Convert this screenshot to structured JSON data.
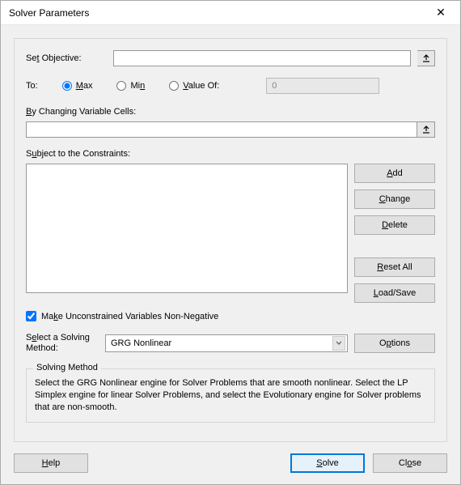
{
  "title": "Solver Parameters",
  "labels": {
    "setObjective": "Set Objective:",
    "to": "To:",
    "byChanging": "By Changing Variable Cells:",
    "subjectTo": "Subject to the Constraints:",
    "makeUnconstrained": "Make Unconstrained Variables Non-Negative",
    "selectMethod1": "Select a Solving",
    "selectMethod2": "Method:",
    "solvingMethodGroup": "Solving Method",
    "solvingMethodDesc": "Select the GRG Nonlinear engine for Solver Problems that are smooth nonlinear. Select the LP Simplex engine for linear Solver Problems, and select the Evolutionary engine for Solver problems that are non-smooth."
  },
  "radios": {
    "max": "Max",
    "min": "Min",
    "valueOf": "Value Of:"
  },
  "valueOfInput": "0",
  "method": "GRG Nonlinear",
  "buttons": {
    "add": "Add",
    "change": "Change",
    "delete": "Delete",
    "resetAll": "Reset All",
    "loadSave": "Load/Save",
    "options": "Options",
    "help": "Help",
    "solve": "Solve",
    "close": "Close"
  }
}
